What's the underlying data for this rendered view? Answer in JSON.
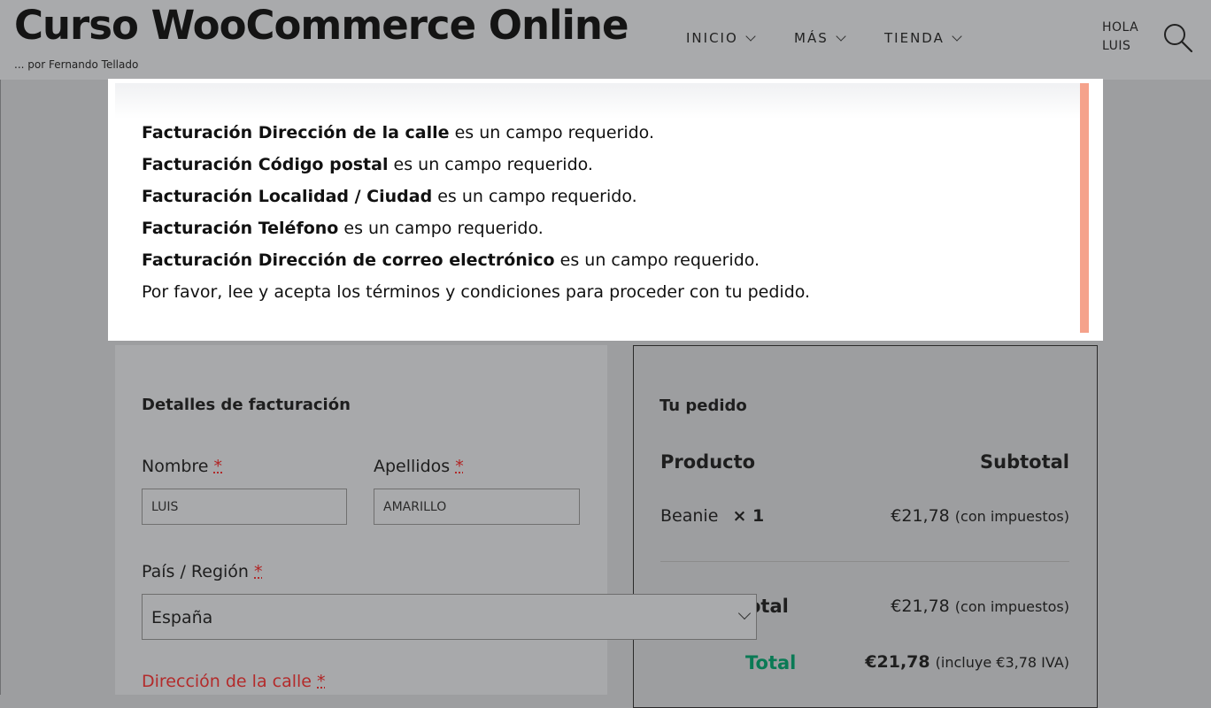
{
  "header": {
    "site_title": "Curso WooCommerce Online",
    "tagline": "... por Fernando Tellado",
    "nav": [
      {
        "label": "INICIO"
      },
      {
        "label": "MÁS"
      },
      {
        "label": "TIENDA"
      }
    ],
    "greeting_line1": "HOLA",
    "greeting_line2": "LUIS"
  },
  "notice": {
    "errors": [
      {
        "field": "Facturación Dirección de la calle",
        "message": " es un campo requerido."
      },
      {
        "field": "Facturación Código postal",
        "message": " es un campo requerido."
      },
      {
        "field": "Facturación Localidad / Ciudad",
        "message": " es un campo requerido."
      },
      {
        "field": "Facturación Teléfono",
        "message": " es un campo requerido."
      },
      {
        "field": "Facturación Dirección de correo electrónico",
        "message": " es un campo requerido."
      },
      {
        "field": "",
        "message": "Por favor, lee y acepta los términos y condiciones para proceder con tu pedido."
      }
    ],
    "accent_color": "#f5a28b"
  },
  "billing": {
    "heading": "Detalles de facturación",
    "first_name_label": "Nombre",
    "first_name_value": "LUIS",
    "last_name_label": "Apellidos",
    "last_name_value": "AMARILLO",
    "country_label": "País / Región",
    "country_value": "España",
    "street_label": "Dirección de la calle",
    "required_mark": "*"
  },
  "order": {
    "heading": "Tu pedido",
    "col_product": "Producto",
    "col_subtotal": "Subtotal",
    "item_name": "Beanie",
    "item_qty": "× 1",
    "item_price": "€21,78",
    "item_tax_note": "(con impuestos)",
    "subtotal_label_partial": "otal",
    "subtotal_value": "€21,78",
    "subtotal_tax_note": "(con impuestos)",
    "total_label": "Total",
    "total_value": "€21,78",
    "total_tax_note": "(incluye €3,78 IVA)",
    "total_color": "#0a7a55"
  }
}
